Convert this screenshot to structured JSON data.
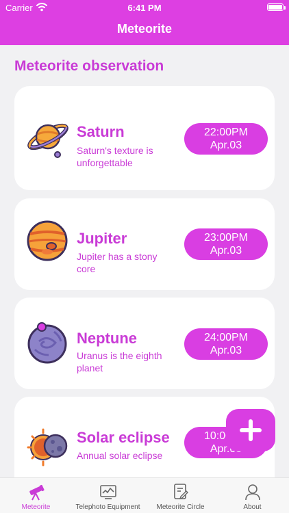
{
  "status_bar": {
    "carrier": "Carrier",
    "time": "6:41 PM"
  },
  "nav": {
    "title": "Meteorite"
  },
  "section_title": "Meteorite observation",
  "cards": [
    {
      "name": "Saturn",
      "description": "Saturn's texture is unforgettable",
      "time": "22:00PM",
      "date": "Apr.03",
      "icon": "saturn-icon"
    },
    {
      "name": "Jupiter",
      "description": "Jupiter has a stony core",
      "time": "23:00PM",
      "date": "Apr.03",
      "icon": "jupiter-icon"
    },
    {
      "name": "Neptune",
      "description": "Uranus is the eighth planet",
      "time": "24:00PM",
      "date": "Apr.03",
      "icon": "neptune-icon"
    },
    {
      "name": "Solar eclipse",
      "description": "Annual solar eclipse",
      "time": "10:00PM",
      "date": "Apr.03",
      "icon": "solar-eclipse-icon"
    }
  ],
  "tabs": [
    {
      "label": "Meteorite",
      "icon": "telescope-icon",
      "active": true
    },
    {
      "label": "Telephoto Equipment",
      "icon": "monitor-icon",
      "active": false
    },
    {
      "label": "Meteorite Circle",
      "icon": "edit-note-icon",
      "active": false
    },
    {
      "label": "About",
      "icon": "person-icon",
      "active": false
    }
  ],
  "colors": {
    "accent": "#dd3fe2",
    "text_accent": "#c93bd6",
    "background": "#f1f1f3"
  }
}
